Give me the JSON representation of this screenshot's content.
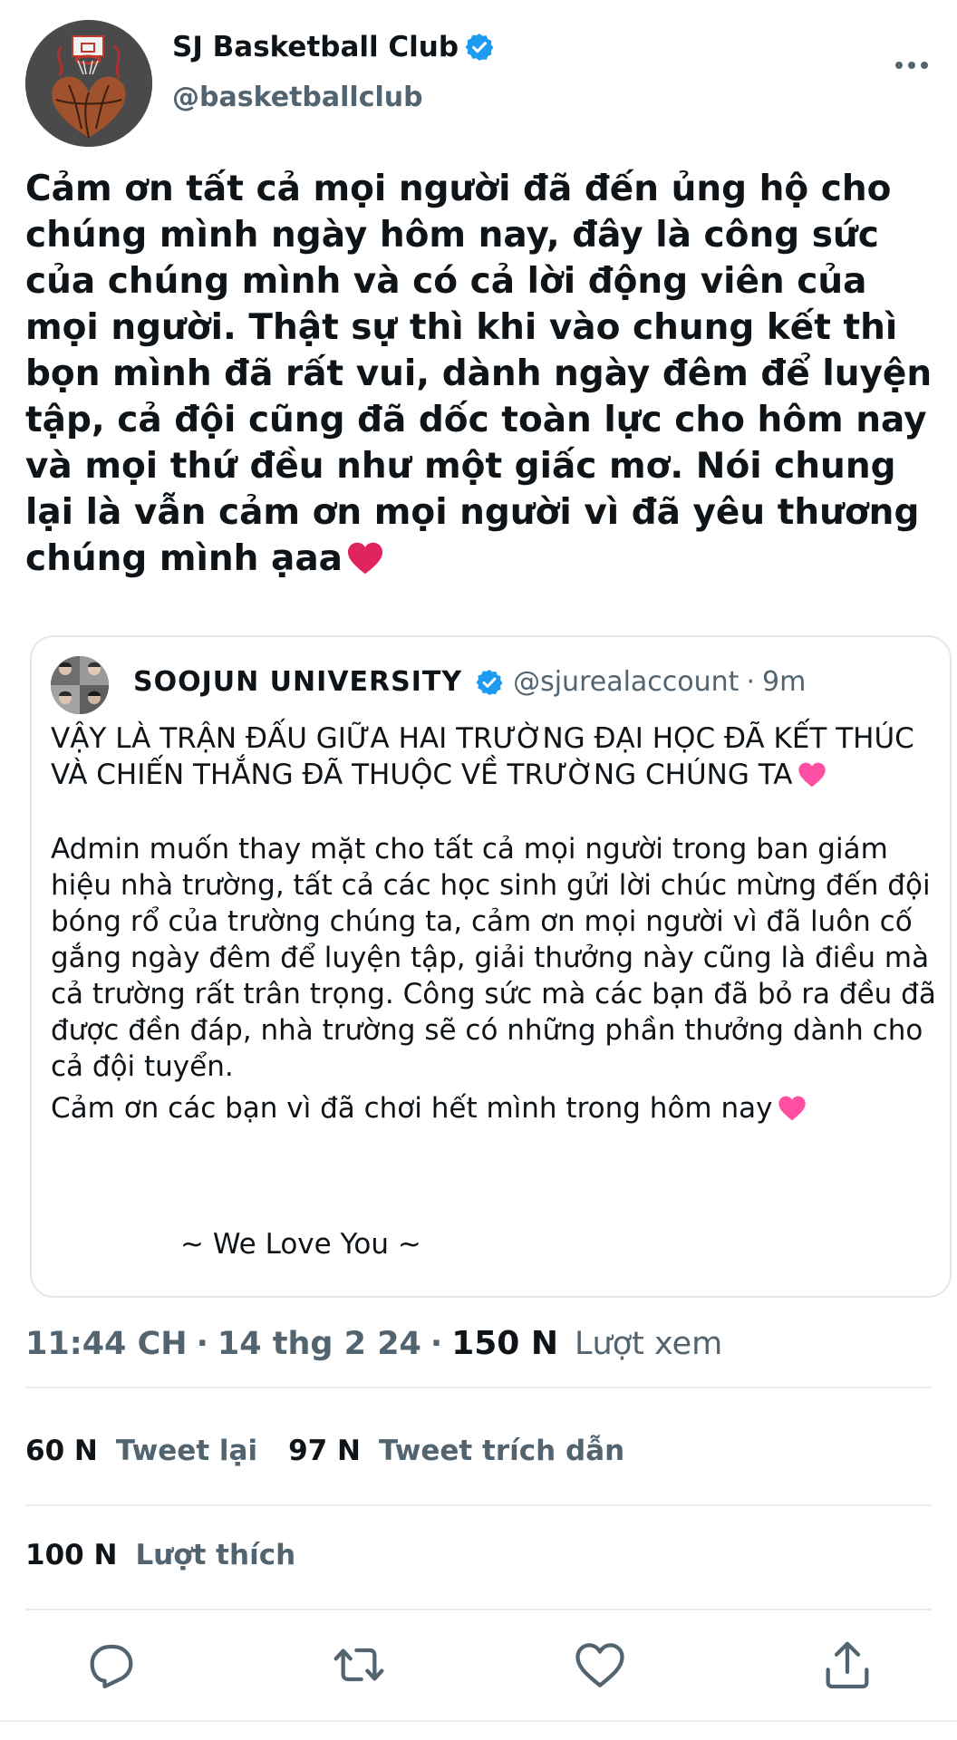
{
  "author": {
    "display_name": "SJ Basketball Club",
    "handle": "@basketballclub",
    "verified": true
  },
  "tweet": {
    "text": "Cảm ơn tất cả mọi người đã đến ủng hộ cho chúng mình ngày hôm nay, đây là công sức của chúng mình và có cả lời động viên của mọi người. Thật sự thì khi vào chung kết thì bọn mình đã rất vui, dành ngày đêm để luyện tập, cả đội cũng đã dốc toàn lực cho hôm nay và mọi thứ đều như một giấc mơ. Nói chung lại là vẫn cảm ơn mọi người vì đã yêu thương chúng mình ạaa",
    "trailing_emoji": "red-heart"
  },
  "quoted_tweet": {
    "display_name": "SOOJUN UNIVERSITY",
    "handle": "@sjurealaccount",
    "separator": "·",
    "time": "9m",
    "verified": true,
    "paragraph_1": "VẬY LÀ TRẬN ĐẤU GIỮA HAI TRƯỜNG ĐẠI HỌC ĐÃ KẾT THÚC VÀ CHIẾN THẮNG ĐÃ THUỘC VỀ TRƯỜNG CHÚNG TA",
    "paragraph_2": "Admin muốn thay mặt cho tất cả mọi người trong ban giám hiệu nhà trường, tất cả các học sinh gửi lời chúc mừng đến đội bóng rổ của trường chúng ta, cảm ơn mọi người vì đã luôn cố gắng ngày đêm để luyện tập, giải thưởng này cũng là điều mà cả trường rất trân trọng. Công sức mà các bạn đã bỏ ra đều đã được đền đáp, nhà trường sẽ có những phần thưởng dành cho cả đội tuyển.",
    "paragraph_3": "Cảm ơn các bạn vì đã chơi hết mình trong hôm nay",
    "signoff": "~ We Love You ~",
    "emoji": "pink-heart"
  },
  "meta": {
    "time": "11:44 CH",
    "dot": "·",
    "date": "14 thg 2 24",
    "views_count": "150 N",
    "views_label": "Lượt xem"
  },
  "stats": {
    "retweets_count": "60 N",
    "retweets_label": "Tweet lại",
    "quotes_count": "97 N",
    "quotes_label": "Tweet trích dẫn",
    "likes_count": "100 N",
    "likes_label": "Lượt thích"
  },
  "actions": [
    "reply-icon",
    "retweet-icon",
    "like-icon",
    "share-icon"
  ],
  "colors": {
    "verified_blue": "#1d9bf0",
    "secondary_text": "#536471",
    "primary_text": "#0f1419",
    "border": "#e1e8ed",
    "heart_red": "#e0245e",
    "heart_pink": "#ff4fa3"
  }
}
